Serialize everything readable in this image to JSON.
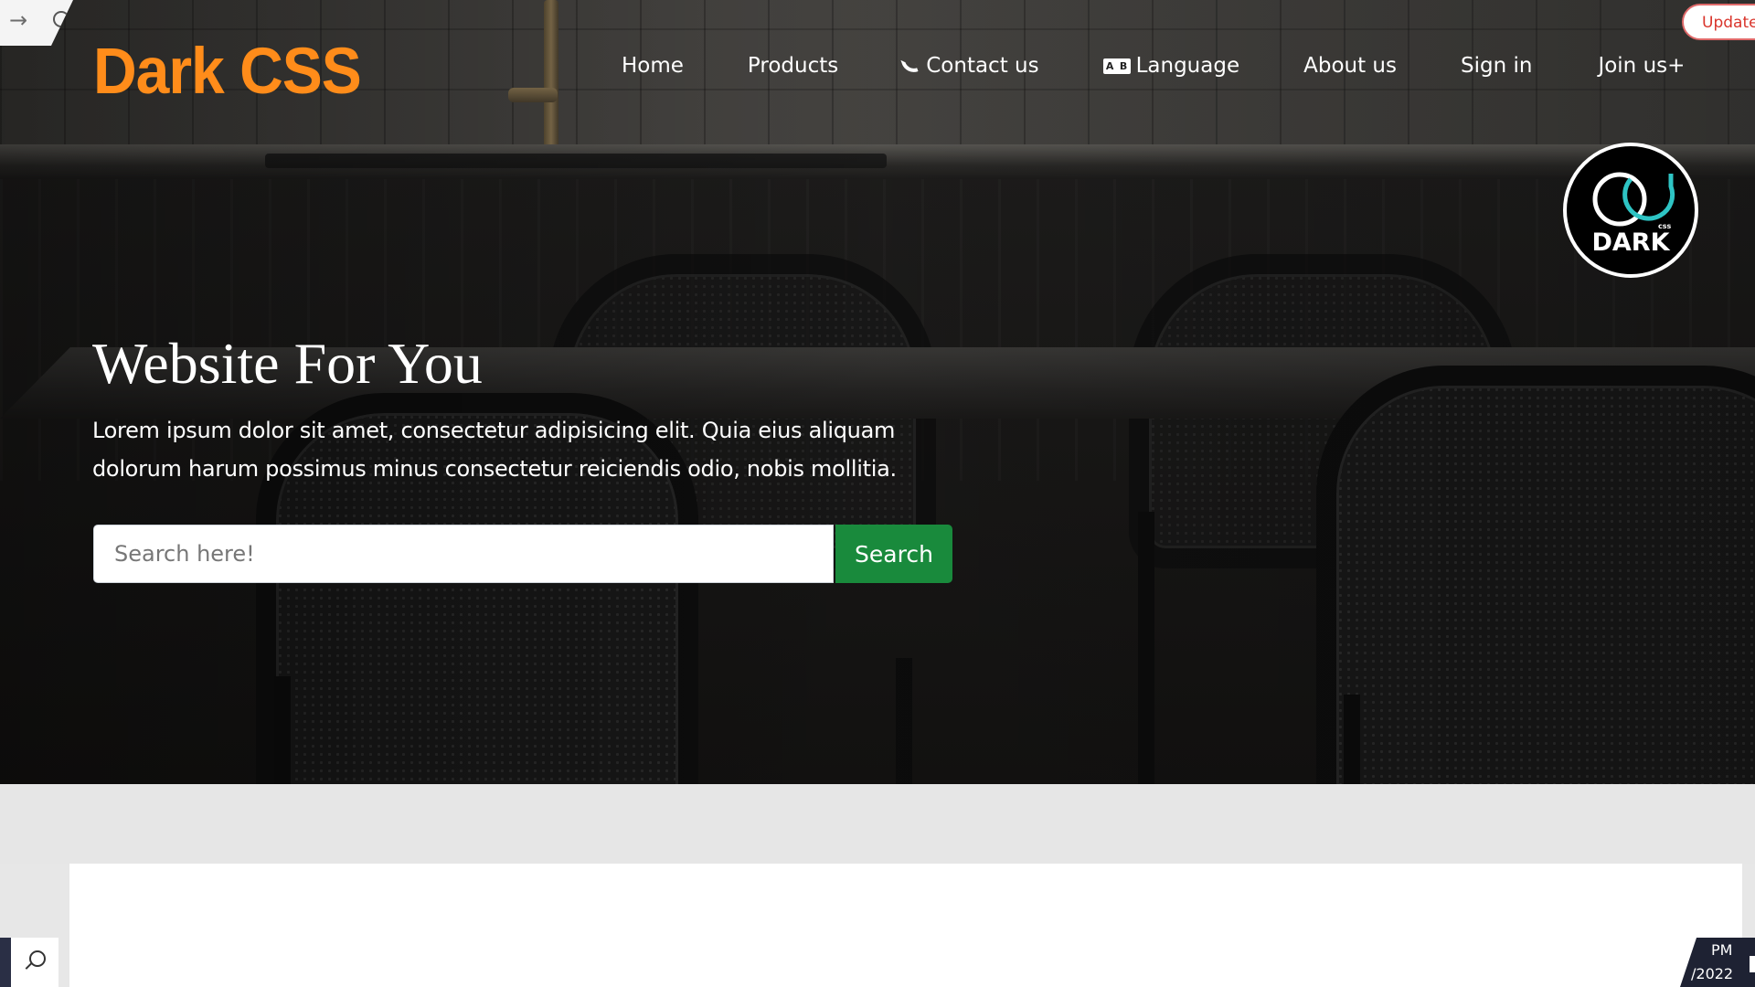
{
  "browser": {
    "update_label": "Update"
  },
  "navbar": {
    "brand": "Dark CSS",
    "items": [
      {
        "label": "Home",
        "icon": null
      },
      {
        "label": "Products",
        "icon": null
      },
      {
        "label": "Contact us",
        "icon": "phone-icon"
      },
      {
        "label": "Language",
        "icon": "language-icon"
      },
      {
        "label": "About us",
        "icon": null
      },
      {
        "label": "Sign in",
        "icon": null
      },
      {
        "label": "Join us+",
        "icon": null
      }
    ]
  },
  "badge": {
    "text": "DARK",
    "small_text": "css"
  },
  "hero": {
    "title": "Website For You",
    "text_line1": "Lorem ipsum dolor sit amet, consectetur adipisicing elit. Quia eius aliquam",
    "text_line2": "dolorum harum possimus minus consectetur reiciendis odio, nobis mollitia.",
    "search_placeholder": "Search here!",
    "search_button": "Search"
  },
  "taskbar": {
    "time": "PM",
    "date": "/2022"
  },
  "colors": {
    "brand": "#ff8c1a",
    "search_button": "#198a3c",
    "update_pill": "#d9342b"
  }
}
